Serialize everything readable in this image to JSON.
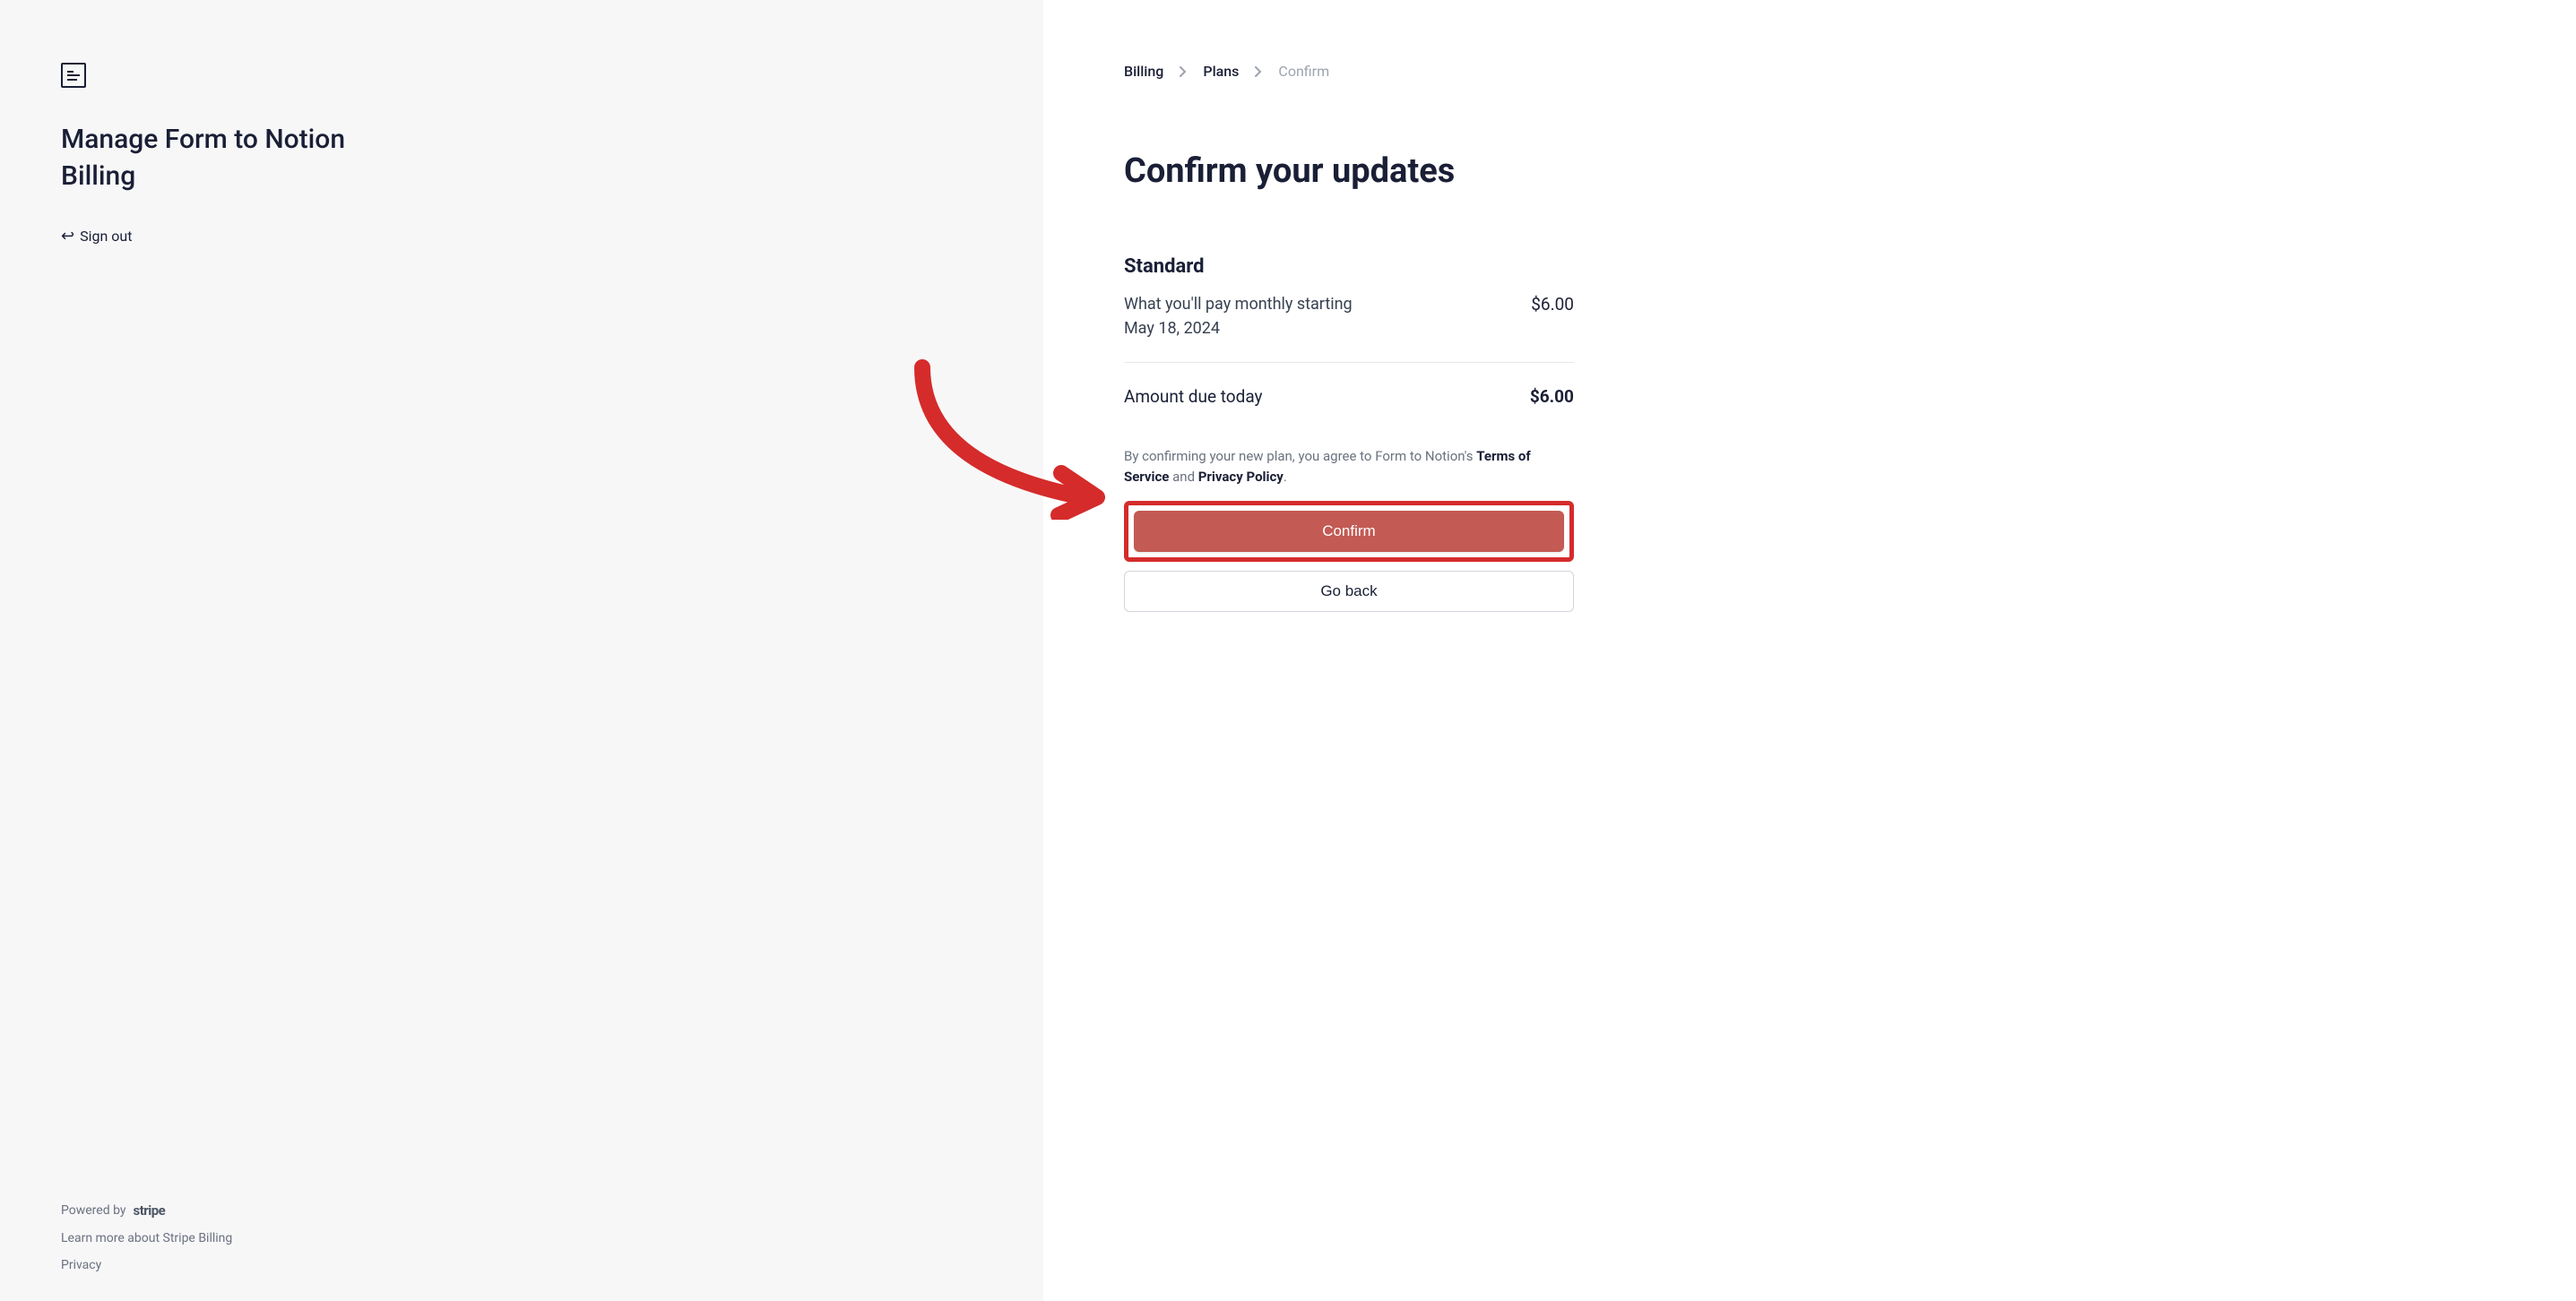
{
  "sidebar": {
    "title": "Manage Form to Notion Billing",
    "signout_label": "Sign out",
    "powered_by_label": "Powered by",
    "stripe_label": "stripe",
    "learn_more_label": "Learn more about Stripe Billing",
    "privacy_label": "Privacy"
  },
  "breadcrumb": {
    "items": [
      "Billing",
      "Plans",
      "Confirm"
    ]
  },
  "main": {
    "title": "Confirm your updates",
    "plan_name": "Standard",
    "pay_label_line1": "What you'll pay monthly starting",
    "pay_label_line2": "May 18, 2024",
    "pay_price": "$6.00",
    "amount_label": "Amount due today",
    "amount_price": "$6.00",
    "terms_prefix": "By confirming your new plan, you agree to Form to Notion's ",
    "terms_of_service": "Terms of Service",
    "terms_and": " and ",
    "privacy_policy": "Privacy Policy",
    "terms_suffix": ".",
    "confirm_button": "Confirm",
    "go_back_button": "Go back"
  },
  "annotation": {
    "color": "#d52b2b"
  }
}
